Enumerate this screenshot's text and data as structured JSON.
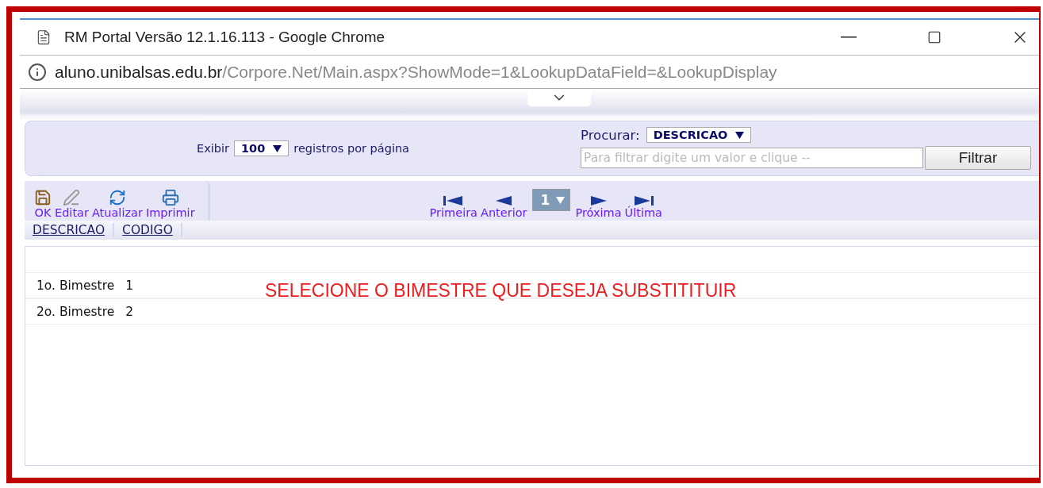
{
  "window": {
    "title": "RM Portal Versão 12.1.16.113 - Google Chrome"
  },
  "address_bar": {
    "host": "aluno.unibalsas.edu.br",
    "path": "/Corpore.Net/Main.aspx?ShowMode=1&LookupDataField=&LookupDisplay"
  },
  "paging_panel": {
    "show_label": "Exibir",
    "page_size": "100",
    "suffix": "registros por página"
  },
  "search": {
    "label": "Procurar:",
    "field": "DESCRICAO",
    "placeholder": "Para filtrar digite um valor e clique --",
    "button": "Filtrar"
  },
  "toolbar": [
    {
      "label": "OK",
      "kind": "save"
    },
    {
      "label": "Editar",
      "kind": "edit"
    },
    {
      "label": "Atualizar",
      "kind": "refresh"
    },
    {
      "label": "Imprimir",
      "kind": "print"
    }
  ],
  "pager": [
    {
      "label": "Primeira",
      "kind": "first"
    },
    {
      "label": "Anterior",
      "kind": "prev"
    },
    {
      "label": "1",
      "kind": "page"
    },
    {
      "label": "Próxima",
      "kind": "next"
    },
    {
      "label": "Última",
      "kind": "last"
    }
  ],
  "table": {
    "columns": [
      "DESCRICAO",
      "CODIGO"
    ],
    "rows": [
      [
        "1o. Bimestre",
        "1"
      ],
      [
        "2o. Bimestre",
        "2"
      ]
    ]
  },
  "annotation": "SELECIONE O BIMESTRE QUE DESEJA SUBSTITITUIR"
}
